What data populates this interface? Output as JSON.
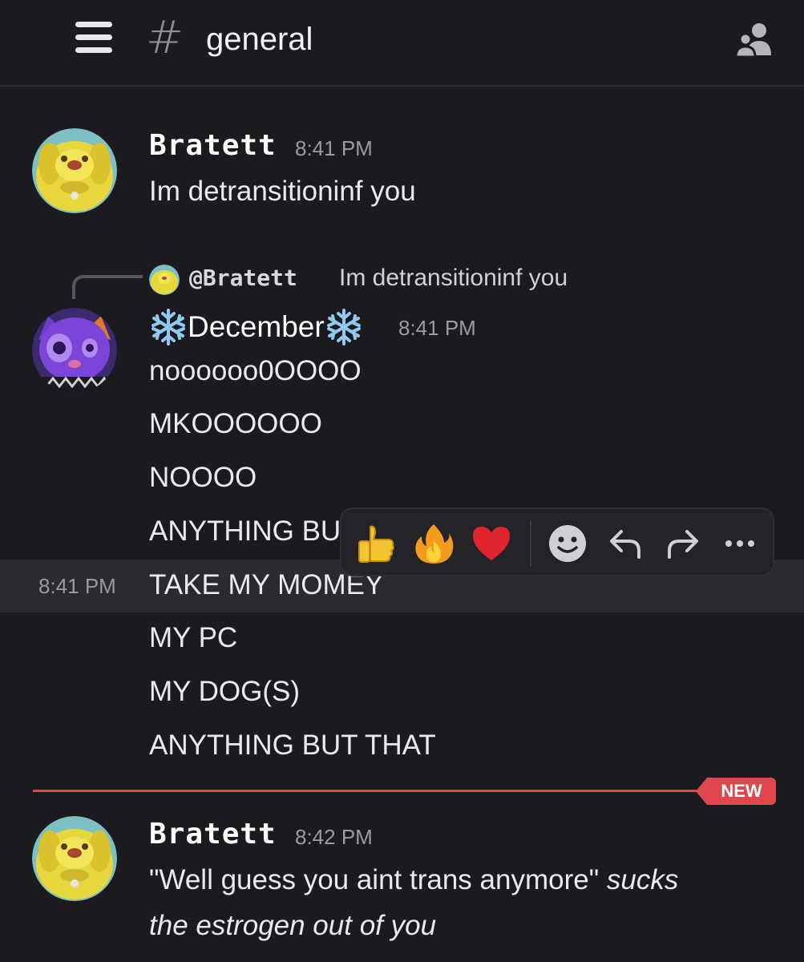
{
  "header": {
    "hash_symbol": "#",
    "channel_name": "general"
  },
  "messages": [
    {
      "username": "Bratett",
      "time": "8:41 PM",
      "lines": [
        "Im detransitioninf you"
      ]
    },
    {
      "reply": {
        "mention": "@Bratett",
        "text": "Im detransitioninf you"
      },
      "username": "December",
      "time": "8:41 PM",
      "lines": [
        "noooooo0OOOO",
        "MKOOOOOO",
        "NOOOO",
        "ANYTHING BU",
        "TAKE MY MOMEY",
        "MY PC",
        "MY DOG(S)",
        "ANYTHING BUT THAT"
      ],
      "hover_time": "8:41 PM"
    },
    {
      "username": "Bratett",
      "time": "8:42 PM",
      "text_plain": "\"Well guess you aint trans anymore\" ",
      "text_italic_1": "sucks",
      "text_italic_2": "the estrogen out of you"
    }
  ],
  "new_divider": {
    "label": "NEW"
  },
  "toolbar": {
    "reactions": [
      "thumbs-up",
      "fire",
      "red-heart"
    ],
    "actions": [
      "add-reaction",
      "reply",
      "forward",
      "more"
    ]
  },
  "colors": {
    "background": "#1b1b1f",
    "new_red": "#e0474d",
    "hover_row": "#2a2a30"
  }
}
